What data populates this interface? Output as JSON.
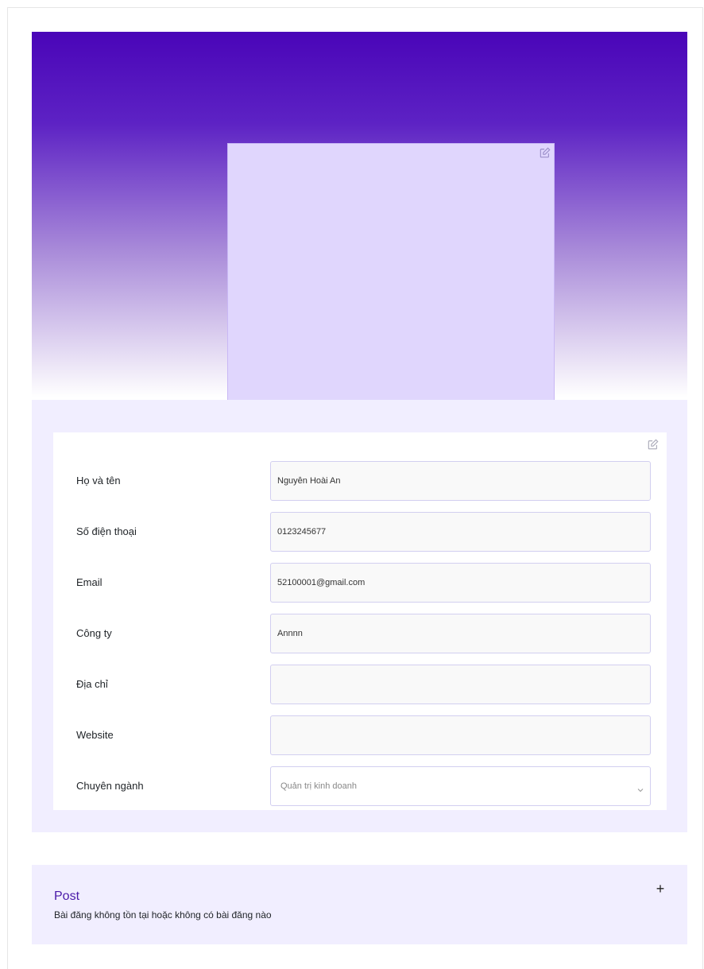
{
  "colors": {
    "hero_top": "#4a05b8",
    "photo_bg": "#e0d6fd",
    "section_bg": "#f1eeff",
    "accent": "#4a1aa8"
  },
  "icons": {
    "photo_edit": "edit-icon",
    "profile_edit": "edit-icon",
    "select_caret": "chevron-down-icon",
    "post_add": "plus-icon"
  },
  "profile": {
    "fields": [
      {
        "label": "Họ và tên",
        "value": "Nguyễn Hoài An"
      },
      {
        "label": "Số điện thoại",
        "value": "0123245677"
      },
      {
        "label": "Email",
        "value": "52100001@gmail.com"
      },
      {
        "label": "Công ty",
        "value": "Annnn"
      },
      {
        "label": "Địa chỉ",
        "value": ""
      },
      {
        "label": "Website",
        "value": ""
      }
    ],
    "major": {
      "label": "Chuyên ngành",
      "value": "Quản trị kinh doanh"
    }
  },
  "post": {
    "title": "Post",
    "empty_message": "Bài đăng không tồn tại hoặc không có bài đăng nào",
    "add_label": "+"
  }
}
